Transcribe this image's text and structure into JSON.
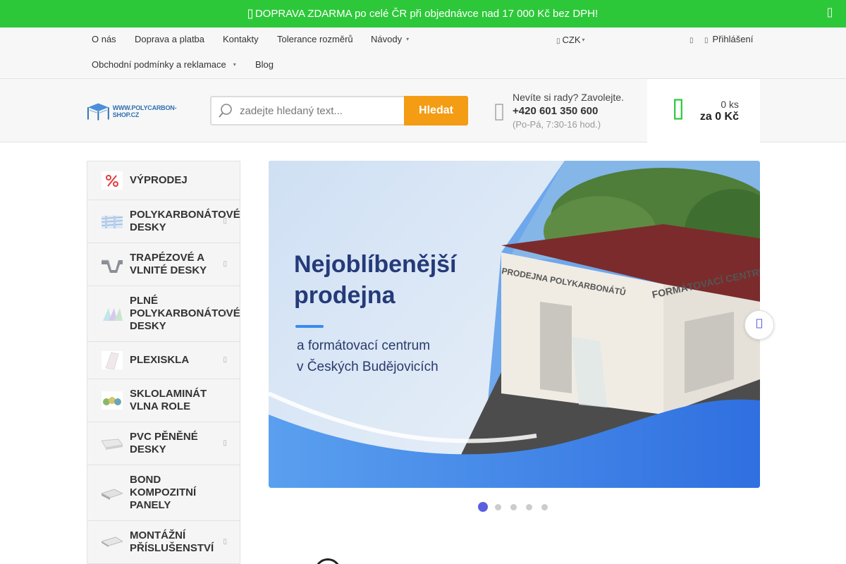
{
  "topbar": {
    "icon": "truck-icon",
    "message": "DOPRAVA ZDARMA po celé ČR při objednávce nad 17 000 Kč bez DPH!",
    "close_icon": "close-icon"
  },
  "nav": {
    "links": [
      "O nás",
      "Doprava a platba",
      "Kontakty",
      "Tolerance rozměrů",
      "Návody",
      "Obchodní podmínky a reklamace",
      "Blog"
    ],
    "currency": "CZK",
    "login": "Přihlášení"
  },
  "header": {
    "logo_text": "WWW.POLYCARBON-SHOP.CZ",
    "search_placeholder": "zadejte hledaný text...",
    "search_button": "Hledat",
    "help_question": "Nevíte si rady? Zavolejte.",
    "phone": "+420 601 350 600",
    "hours": "(Po-Pá, 7:30-16 hod.)",
    "cart_count": "0 ks",
    "cart_total": "za 0 Kč"
  },
  "categories": [
    {
      "label": "Výprodej",
      "lines": [
        "VÝPRODEJ"
      ],
      "has_arrow": false
    },
    {
      "label": "Polykarbonátové desky",
      "lines": [
        "POLYKARBONÁTOVÉ",
        "DESKY"
      ],
      "has_arrow": true
    },
    {
      "label": "Trapézové a vlnité desky",
      "lines": [
        "TRAPÉZOVÉ A",
        "VLNITÉ DESKY"
      ],
      "has_arrow": true
    },
    {
      "label": "Plné polykarbonátové desky",
      "lines": [
        "PLNÉ",
        "POLYKARBONÁTOVÉ",
        "DESKY"
      ],
      "has_arrow": true
    },
    {
      "label": "Plexiskla",
      "lines": [
        "PLEXISKLA"
      ],
      "has_arrow": true
    },
    {
      "label": "Sklolaminát vlna role",
      "lines": [
        "SKLOLAMINÁT",
        "VLNA ROLE"
      ],
      "has_arrow": false
    },
    {
      "label": "PVC pěněné desky",
      "lines": [
        "PVC PĚNĚNÉ",
        "DESKY"
      ],
      "has_arrow": true
    },
    {
      "label": "Bond kompozitní panely",
      "lines": [
        "BOND",
        "KOMPOZITNÍ",
        "PANELY"
      ],
      "has_arrow": false
    },
    {
      "label": "Montážní příslušenství",
      "lines": [
        "MONTÁŽNÍ",
        "PŘÍSLUŠENSTVÍ"
      ],
      "has_arrow": true
    }
  ],
  "banner": {
    "heading_line1": "Nejoblíbenější",
    "heading_line2": "prodejna",
    "sub_line1": "a formátovací centrum",
    "sub_line2": "v Českých Budějovicích",
    "building_sign1": "PRODEJNA POLYKARBONÁTŮ",
    "building_sign2": "FORMÁTOVACÍ CENTRUM",
    "active_slide": 1,
    "slides": 5
  },
  "colors": {
    "topbar": "#2dc83a",
    "search_button": "#f39c14",
    "cart_icon": "#2dc83a",
    "dot_active": "#5a5fe0"
  }
}
